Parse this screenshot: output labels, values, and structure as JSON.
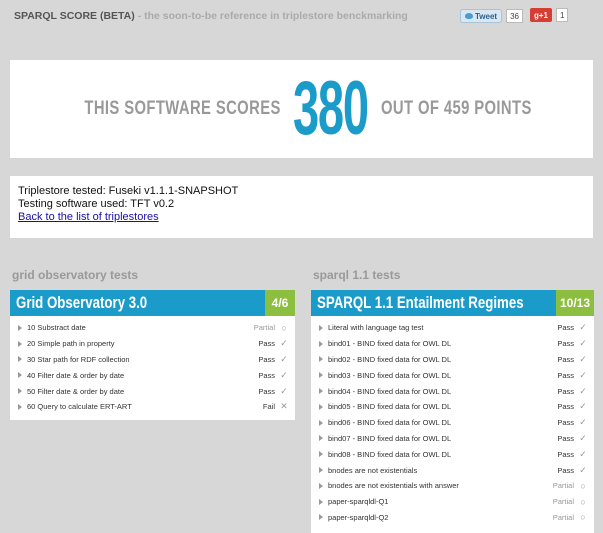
{
  "header": {
    "brand": "SPARQL SCORE (BETA)",
    "tagline": "- the soon-to-be reference in triplestore benckmarking",
    "tweet_label": "Tweet",
    "tweet_count": "36",
    "gplus_label": "g+1",
    "gplus_count": "1"
  },
  "score": {
    "prefix": "THIS SOFTWARE SCORES",
    "value": "380",
    "suffix": "OUT OF 459 POINTS"
  },
  "info": {
    "triplestore": "Triplestore tested: Fuseki v1.1.1-SNAPSHOT",
    "software": "Testing software used: TFT v0.2",
    "back_link": "Back to the list of triplestores"
  },
  "sections": [
    {
      "title": "grid observatory tests",
      "panel_name": "Grid Observatory 3.0",
      "ratio": "4/6",
      "rows": [
        {
          "label": "10 Substract date",
          "status": "Partial",
          "icon": "○"
        },
        {
          "label": "20 Simple path in property",
          "status": "Pass",
          "icon": "✓"
        },
        {
          "label": "30 Star path for RDF collection",
          "status": "Pass",
          "icon": "✓"
        },
        {
          "label": "40 Filter date & order by date",
          "status": "Pass",
          "icon": "✓"
        },
        {
          "label": "50 Filter date & order by date",
          "status": "Pass",
          "icon": "✓"
        },
        {
          "label": "60 Query to calculate ERT-ART",
          "status": "Fail",
          "icon": "✕"
        }
      ]
    },
    {
      "title": "sparql 1.1 tests",
      "panel_name": "SPARQL 1.1 Entailment Regimes",
      "ratio": "10/13",
      "rows": [
        {
          "label": "Literal with language tag test",
          "status": "Pass",
          "icon": "✓"
        },
        {
          "label": "bind01 - BIND fixed data for OWL DL",
          "status": "Pass",
          "icon": "✓"
        },
        {
          "label": "bind02 - BIND fixed data for OWL DL",
          "status": "Pass",
          "icon": "✓"
        },
        {
          "label": "bind03 - BIND fixed data for OWL DL",
          "status": "Pass",
          "icon": "✓"
        },
        {
          "label": "bind04 - BIND fixed data for OWL DL",
          "status": "Pass",
          "icon": "✓"
        },
        {
          "label": "bind05 - BIND fixed data for OWL DL",
          "status": "Pass",
          "icon": "✓"
        },
        {
          "label": "bind06 - BIND fixed data for OWL DL",
          "status": "Pass",
          "icon": "✓"
        },
        {
          "label": "bind07 - BIND fixed data for OWL DL",
          "status": "Pass",
          "icon": "✓"
        },
        {
          "label": "bind08 - BIND fixed data for OWL DL",
          "status": "Pass",
          "icon": "✓"
        },
        {
          "label": "bnodes are not existentials",
          "status": "Pass",
          "icon": "✓"
        },
        {
          "label": "bnodes are not existentials with answer",
          "status": "Partial",
          "icon": "○"
        },
        {
          "label": "paper-sparqldl-Q1",
          "status": "Partial",
          "icon": "○"
        },
        {
          "label": "paper-sparqldl-Q2",
          "status": "Partial",
          "icon": "○"
        }
      ]
    }
  ]
}
